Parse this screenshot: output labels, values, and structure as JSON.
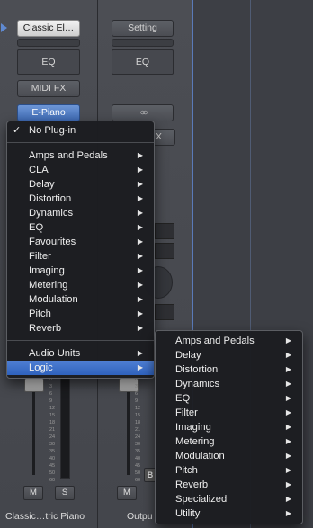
{
  "strip1": {
    "instrument": "Classic El…",
    "eq": "EQ",
    "midi_fx": "MIDI FX",
    "plugin": "E-Piano",
    "name": "Classic…tric Piano",
    "mute": "M",
    "solo": "S"
  },
  "strip2": {
    "setting": "Setting",
    "eq": "EQ",
    "link_icon": "stereo-link-icon",
    "fx_partial": "X",
    "name": "Outpu",
    "mute": "M",
    "bounce": "B"
  },
  "meter_scale": [
    "0",
    "3",
    "6",
    "9",
    "12",
    "15",
    "18",
    "21",
    "24",
    "30",
    "35",
    "40",
    "45",
    "50",
    "60"
  ],
  "plugin_menu": {
    "items": [
      {
        "label": "No Plug-in",
        "checked": true
      },
      {
        "label": "Amps and Pedals",
        "submenu": true
      },
      {
        "label": "CLA",
        "submenu": true
      },
      {
        "label": "Delay",
        "submenu": true
      },
      {
        "label": "Distortion",
        "submenu": true
      },
      {
        "label": "Dynamics",
        "submenu": true
      },
      {
        "label": "EQ",
        "submenu": true
      },
      {
        "label": "Favourites",
        "submenu": true
      },
      {
        "label": "Filter",
        "submenu": true
      },
      {
        "label": "Imaging",
        "submenu": true
      },
      {
        "label": "Metering",
        "submenu": true
      },
      {
        "label": "Modulation",
        "submenu": true
      },
      {
        "label": "Pitch",
        "submenu": true
      },
      {
        "label": "Reverb",
        "submenu": true
      },
      {
        "label": "Audio Units",
        "submenu": true
      },
      {
        "label": "Logic",
        "submenu": true,
        "highlighted": true
      }
    ]
  },
  "logic_submenu": {
    "items": [
      {
        "label": "Amps and Pedals"
      },
      {
        "label": "Delay"
      },
      {
        "label": "Distortion"
      },
      {
        "label": "Dynamics"
      },
      {
        "label": "EQ"
      },
      {
        "label": "Filter"
      },
      {
        "label": "Imaging"
      },
      {
        "label": "Metering"
      },
      {
        "label": "Modulation"
      },
      {
        "label": "Pitch"
      },
      {
        "label": "Reverb"
      },
      {
        "label": "Specialized"
      },
      {
        "label": "Utility"
      }
    ]
  },
  "colors": {
    "highlight": "#3a6dc8",
    "menu_bg": "#1c1d21",
    "strip_bg": "#4a4c52"
  }
}
